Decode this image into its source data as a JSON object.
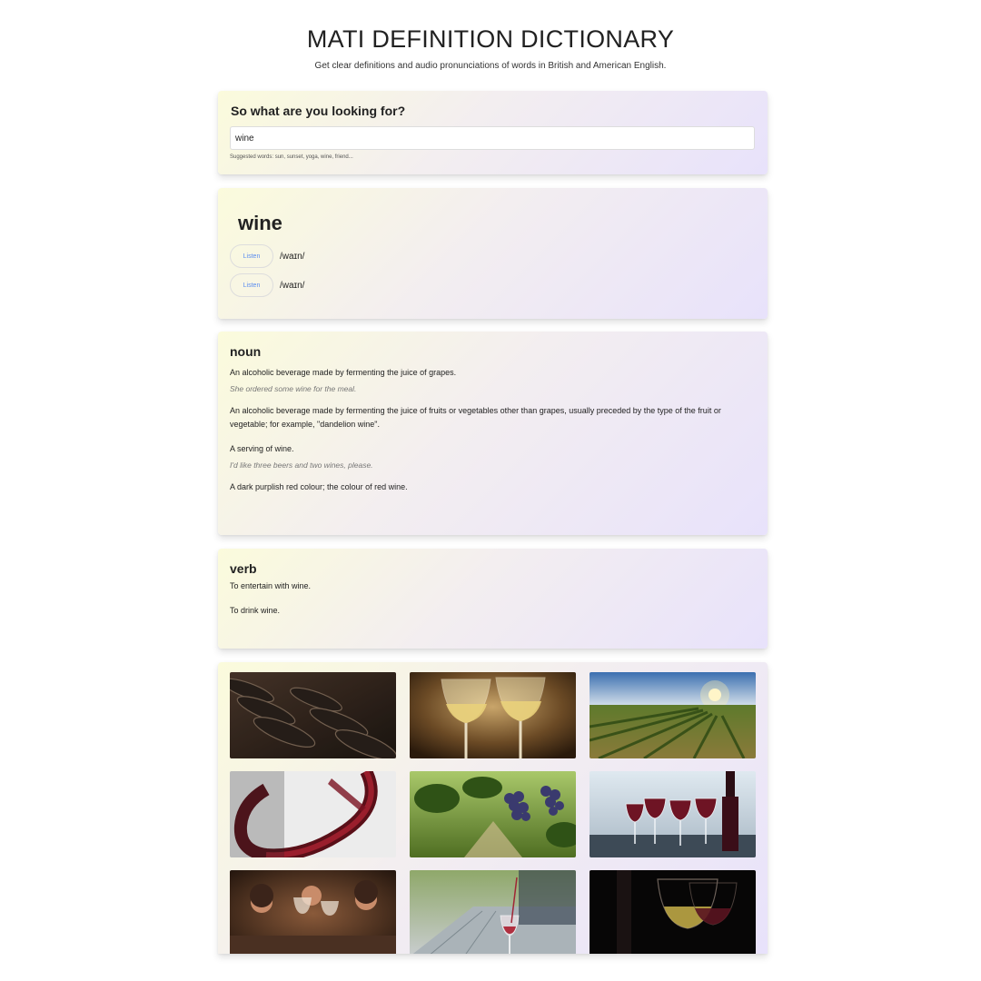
{
  "header": {
    "title": "MATI DEFINITION DICTIONARY",
    "subtitle": "Get clear definitions and audio pronunciations of words in British and American English."
  },
  "search": {
    "question": "So what are you looking for?",
    "value": "wine",
    "suggested": "Suggested words: sun, sunset, yoga, wine, friend..."
  },
  "word": {
    "text": "wine",
    "pronunciations": [
      {
        "button": "Listen",
        "phonetic": "/waɪn/"
      },
      {
        "button": "Listen",
        "phonetic": "/waɪn/"
      }
    ]
  },
  "meanings": [
    {
      "part_of_speech": "noun",
      "definitions": [
        {
          "text": "An alcoholic beverage made by fermenting the juice of grapes.",
          "example": "She ordered some wine for the meal."
        },
        {
          "text": "An alcoholic beverage made by fermenting the juice of fruits or vegetables other than grapes, usually preceded by the type of the fruit or vegetable; for example, \"dandelion wine\".",
          "example": ""
        },
        {
          "text": "A serving of wine.",
          "example": "I'd like three beers and two wines, please."
        },
        {
          "text": "A dark purplish red colour; the colour of red wine.",
          "example": ""
        }
      ]
    },
    {
      "part_of_speech": "verb",
      "definitions": [
        {
          "text": "To entertain with wine.",
          "example": ""
        },
        {
          "text": "To drink wine.",
          "example": ""
        }
      ]
    }
  ],
  "images": [
    {
      "name": "wine-bottles-photo"
    },
    {
      "name": "white-wine-glasses-photo"
    },
    {
      "name": "vineyard-sunset-photo"
    },
    {
      "name": "red-wine-pour-photo"
    },
    {
      "name": "grape-vines-photo"
    },
    {
      "name": "red-wine-glasses-table-photo"
    },
    {
      "name": "friends-toasting-photo"
    },
    {
      "name": "wine-pouring-outdoor-photo"
    },
    {
      "name": "wine-glasses-dark-photo"
    }
  ]
}
